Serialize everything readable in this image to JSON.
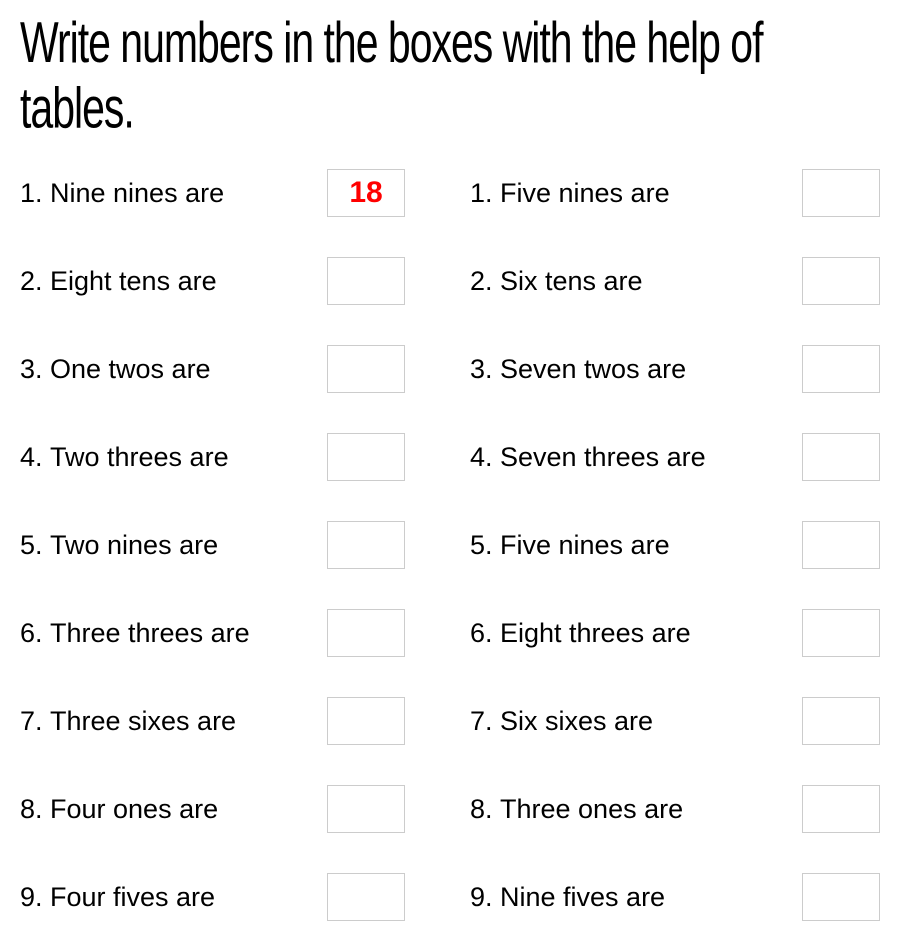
{
  "title": "Write numbers in the boxes with the help of tables.",
  "columns": [
    {
      "items": [
        {
          "num": "1.",
          "prompt": "Nine nines are",
          "value": "18"
        },
        {
          "num": "2.",
          "prompt": "Eight tens are",
          "value": ""
        },
        {
          "num": "3.",
          "prompt": "One twos are",
          "value": ""
        },
        {
          "num": "4.",
          "prompt": "Two threes are",
          "value": ""
        },
        {
          "num": "5.",
          "prompt": "Two nines are",
          "value": ""
        },
        {
          "num": "6.",
          "prompt": "Three threes are",
          "value": ""
        },
        {
          "num": "7.",
          "prompt": "Three sixes are",
          "value": ""
        },
        {
          "num": "8.",
          "prompt": "Four ones are",
          "value": ""
        },
        {
          "num": "9.",
          "prompt": "Four fives are",
          "value": ""
        }
      ]
    },
    {
      "items": [
        {
          "num": "1.",
          "prompt": "Five nines are",
          "value": ""
        },
        {
          "num": "2.",
          "prompt": "Six tens are",
          "value": ""
        },
        {
          "num": "3.",
          "prompt": "Seven twos are",
          "value": ""
        },
        {
          "num": "4.",
          "prompt": "Seven threes are",
          "value": ""
        },
        {
          "num": "5.",
          "prompt": "Five nines are",
          "value": ""
        },
        {
          "num": "6.",
          "prompt": "Eight threes are",
          "value": ""
        },
        {
          "num": "7.",
          "prompt": "Six sixes are",
          "value": ""
        },
        {
          "num": "8.",
          "prompt": "Three ones are",
          "value": ""
        },
        {
          "num": "9.",
          "prompt": "Nine fives are",
          "value": ""
        }
      ]
    }
  ]
}
